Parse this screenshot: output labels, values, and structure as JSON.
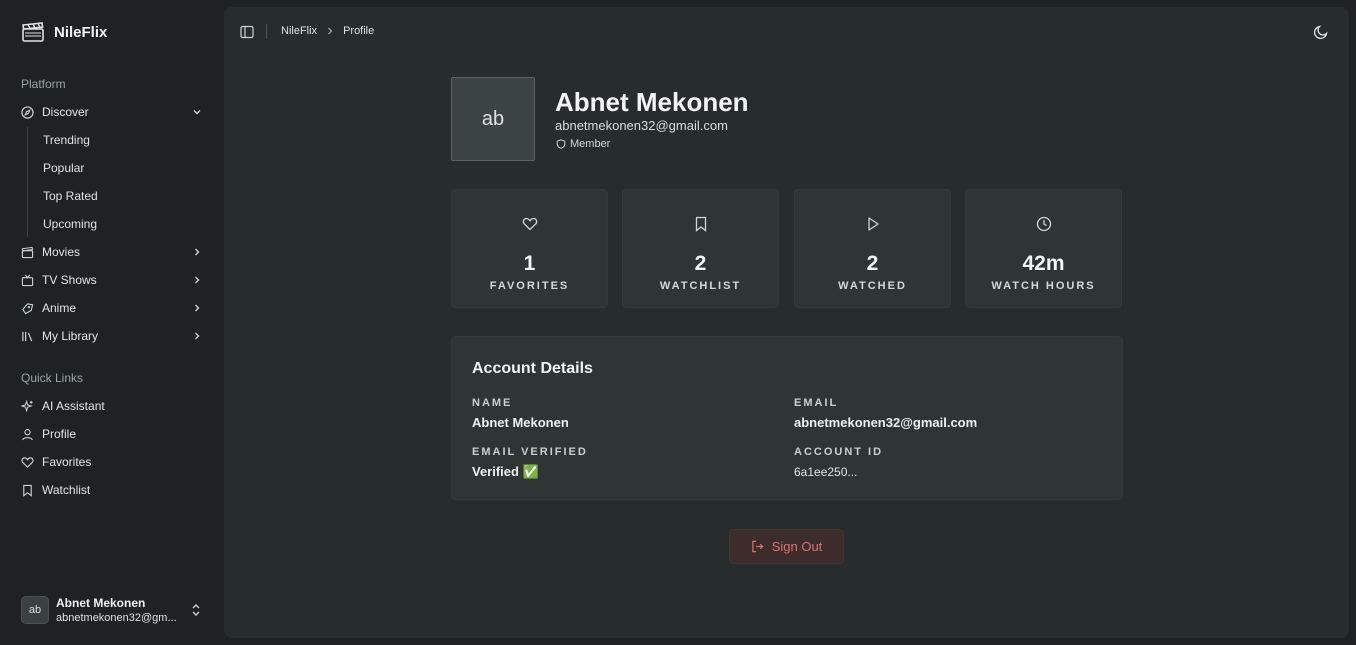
{
  "app": {
    "name": "NileFlix"
  },
  "sidebar": {
    "platform_label": "Platform",
    "discover": {
      "label": "Discover",
      "subitems": [
        "Trending",
        "Popular",
        "Top Rated",
        "Upcoming"
      ]
    },
    "items": [
      {
        "label": "Movies",
        "icon": "film-icon"
      },
      {
        "label": "TV Shows",
        "icon": "tv-icon"
      },
      {
        "label": "Anime",
        "icon": "anime-icon"
      },
      {
        "label": "My Library",
        "icon": "library-icon"
      }
    ],
    "quick_links_label": "Quick Links",
    "quick_links": [
      {
        "label": "AI Assistant",
        "icon": "sparkles-icon"
      },
      {
        "label": "Profile",
        "icon": "user-icon"
      },
      {
        "label": "Favorites",
        "icon": "heart-icon"
      },
      {
        "label": "Watchlist",
        "icon": "bookmark-icon"
      }
    ],
    "user": {
      "initials": "ab",
      "name": "Abnet Mekonen",
      "email": "abnetmekonen32@gm..."
    }
  },
  "breadcrumb": {
    "root": "NileFlix",
    "current": "Profile"
  },
  "profile": {
    "initials": "ab",
    "name": "Abnet Mekonen",
    "email": "abnetmekonen32@gmail.com",
    "role": "Member"
  },
  "stats": [
    {
      "value": "1",
      "label": "FAVORITES",
      "icon": "heart-icon"
    },
    {
      "value": "2",
      "label": "WATCHLIST",
      "icon": "bookmark-icon"
    },
    {
      "value": "2",
      "label": "WATCHED",
      "icon": "play-icon"
    },
    {
      "value": "42m",
      "label": "WATCH HOURS",
      "icon": "clock-icon"
    }
  ],
  "account": {
    "title": "Account Details",
    "name_label": "NAME",
    "name_value": "Abnet Mekonen",
    "email_label": "EMAIL",
    "email_value": "abnetmekonen32@gmail.com",
    "verified_label": "EMAIL VERIFIED",
    "verified_value": "Verified ✅",
    "id_label": "ACCOUNT ID",
    "id_value": "6a1ee250..."
  },
  "actions": {
    "sign_out": "Sign Out"
  },
  "colors": {
    "background": "#1e2222",
    "panel": "#272c2c",
    "card": "#2f3535",
    "danger": "#e26d6d"
  }
}
